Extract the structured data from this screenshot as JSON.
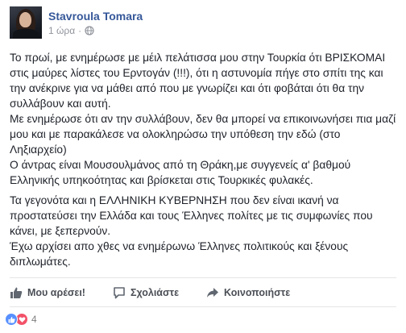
{
  "post": {
    "author": "Stavroula Tomara",
    "timestamp": "1 ώρα",
    "separator": "·",
    "paragraphs": [
      "Το πρωί, με ενημέρωσε με μέιλ πελάτισσα μου στην Τουρκία ότι ΒΡΙΣΚΟΜΑΙ στις μαύρες λίστες του Ερντογάν (!!!), ότι η αστυνομία πήγε στο σπίτι της και την ανέκρινε για να μάθει από που με γνωρίζει και ότι φοβάται ότι θα την συλλάβουν και αυτή.",
      "Με ενημέρωσε ότι αν την συλλάβουν, δεν θα μπορεί να επικοινωνήσει πια μαζί μου και με παρακάλεσε να ολοκληρώσω την υπόθεση την εδώ (στο Ληξιαρχείο)",
      "Ο άντρας είναι Μουσουλμάνος από τη Θράκη,με συγγενείς α' βαθμού Ελληνικής υπηκοότητας και βρίσκεται στις Τουρκικές φυλακές.",
      "Τα γεγονότα και η ΕΛΛΗΝΙΚΗ ΚΥΒΕΡΝΗΣΗ που δεν είναι ικανή να προστατεύσει την Ελλάδα και τους Έλληνες πολίτες με τις συμφωνίες που κάνει, με ξεπερνούν.",
      "Έχω αρχίσει απο χθες να ενημέρωνω Έλληνες πολιτικούς και ξένους διπλωμάτες."
    ]
  },
  "actions": {
    "like_label": "Μου αρέσει!",
    "comment_label": "Σχολιάστε",
    "share_label": "Κοινοποιήστε"
  },
  "reactions": {
    "count": "4"
  },
  "colors": {
    "name": "#365899",
    "meta": "#90949c",
    "like_blue": "#5890ff",
    "love_red": "#f25268"
  }
}
